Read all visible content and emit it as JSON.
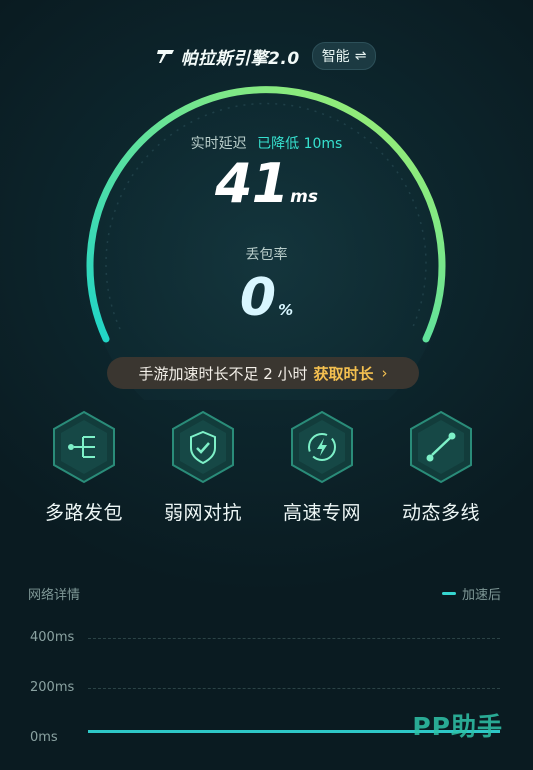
{
  "header": {
    "engine_name": "帕拉斯引擎2.0",
    "mode_label": "智能",
    "mode_icon": "swap-arrows-icon"
  },
  "gauge": {
    "latency_label": "实时延迟",
    "latency_change": "已降低 10ms",
    "latency_value": "41",
    "latency_unit": "ms",
    "loss_label": "丢包率",
    "loss_value": "0",
    "loss_unit": "%",
    "arc_gradient": [
      "#1fd4c8",
      "#a8f06a"
    ]
  },
  "banner": {
    "text": "手游加速时长不足 2 小时",
    "action": "获取时长",
    "chevron": "›"
  },
  "features": [
    {
      "label": "多路发包",
      "icon": "multipath-icon"
    },
    {
      "label": "弱网对抗",
      "icon": "shield-check-icon"
    },
    {
      "label": "高速专网",
      "icon": "lightning-icon"
    },
    {
      "label": "动态多线",
      "icon": "dynamic-line-icon"
    }
  ],
  "chart_data": {
    "type": "line",
    "title": "网络详情",
    "legend": [
      "加速后"
    ],
    "y_ticks": [
      "400ms",
      "200ms",
      "0ms"
    ],
    "ylim": [
      0,
      400
    ],
    "series": [
      {
        "name": "加速后",
        "values": [
          0,
          0
        ]
      }
    ],
    "color": "#2ec8c7"
  },
  "watermark": "PP助手"
}
